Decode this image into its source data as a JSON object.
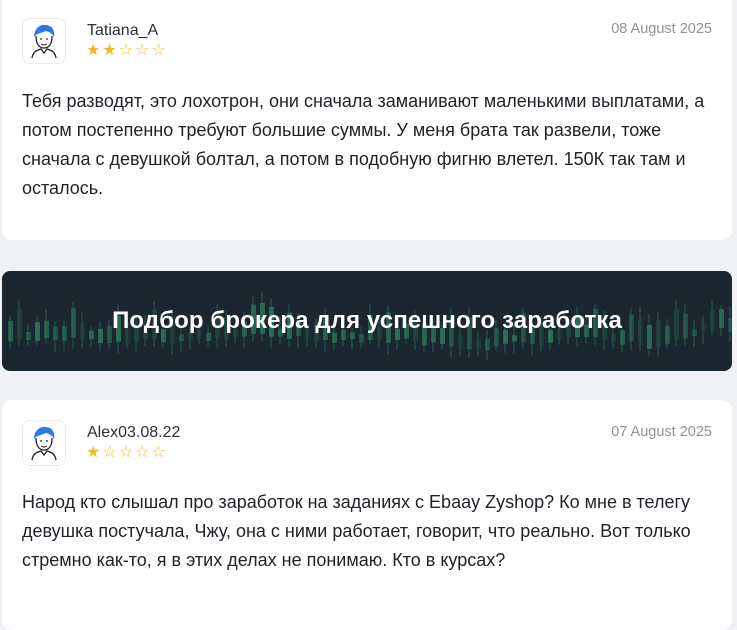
{
  "reviews": [
    {
      "author": "Tatiana_A",
      "date": "08 August 2025",
      "rating": 2,
      "max_rating": 5,
      "text": "Тебя разводят, это лохотрон, они сначала заманивают маленькими выплатами, а потом постепенно требуют большие суммы. У меня брата так развели, тоже сначала с девушкой болтал, а потом в подобную фигню влетел. 150К так там и осталось."
    },
    {
      "author": "Alex03.08.22",
      "date": "07 August 2025",
      "rating": 1,
      "max_rating": 5,
      "text": "Народ кто слышал про заработок на заданиях с Ebaay Zyshop? Ко мне в телегу девушка постучала, Чжу, она с ними работает, говорит, что реально. Вот только стремно как-то, я в этих делах не понимаю. Кто в курсах?"
    }
  ],
  "banner": {
    "title": "Подбор брокера для успешного заработка"
  },
  "icons": {
    "avatar": "user-avatar-icon",
    "star_filled": "star-filled-icon",
    "star_empty": "star-empty-icon"
  },
  "colors": {
    "star": "#f0b822",
    "banner_bg": "#1a2630",
    "candle": "#2e7a5a",
    "date": "#8d939c"
  }
}
